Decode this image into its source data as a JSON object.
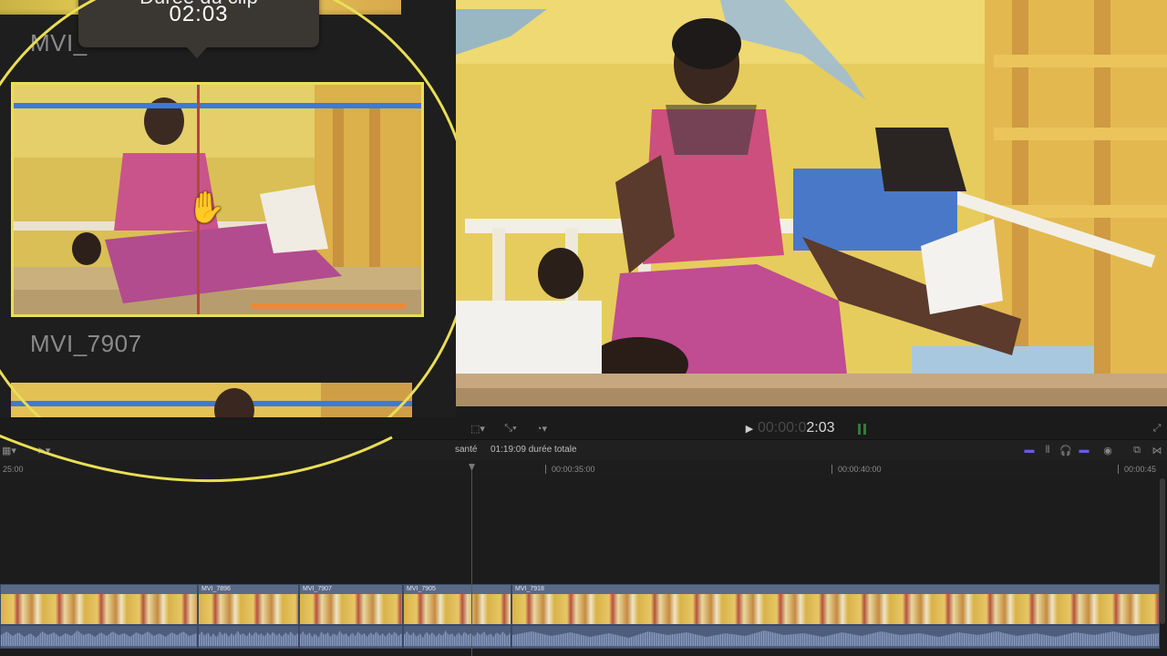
{
  "browser": {
    "tooltip": {
      "title": "Durée du clip",
      "time": "02:03"
    },
    "clips": [
      {
        "label": "MVI_7907"
      }
    ],
    "partial_label": "MVI_"
  },
  "viewer_bar": {
    "timecode_dim": "00:00:0",
    "timecode_bright": "2:03"
  },
  "timeline_header": {
    "project": "santé",
    "duration": "01:19:09 durée totale"
  },
  "ruler": {
    "ticks": [
      "25:00",
      "00:00:35:00",
      "00:00:40:00",
      "00:00:45"
    ]
  },
  "timeline": {
    "clips": [
      {
        "name": ""
      },
      {
        "name": "MVI_7896"
      },
      {
        "name": "MVI_7907"
      },
      {
        "name": "MVI_7905"
      },
      {
        "name": "MVI_7918"
      }
    ]
  },
  "colors": {
    "highlight_circle": "#e9de55",
    "selection_border": "#e9de55",
    "playhead": "#b0483f",
    "clip_blue": "#5a6a86",
    "skimmer_blue": "#3d7ad6"
  }
}
